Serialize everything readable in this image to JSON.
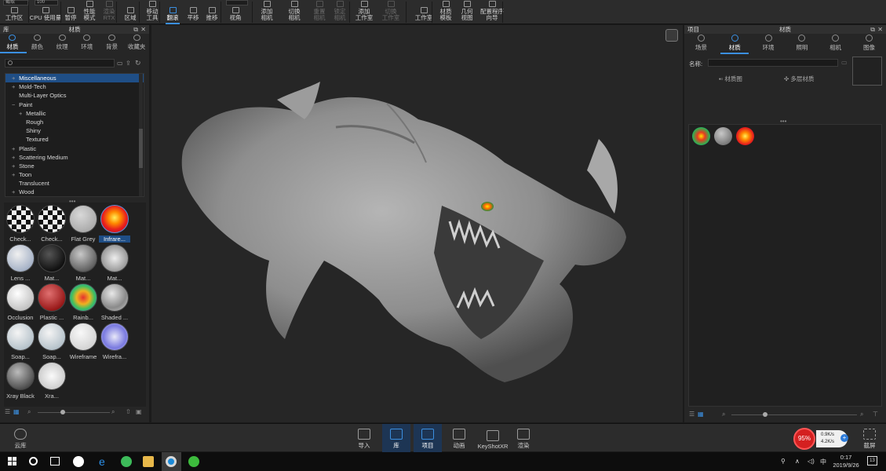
{
  "toolbar": {
    "fields": [
      "截取",
      "100"
    ],
    "buttons": [
      {
        "label": "工作区",
        "state": "normal"
      },
      {
        "label": "CPU 使用量",
        "state": "normal"
      },
      {
        "label": "暂停",
        "state": "normal"
      },
      {
        "label": "性能\n模式",
        "state": "normal"
      },
      {
        "label": "渲染\nRTX",
        "state": "disabled"
      },
      {
        "label": "区域",
        "state": "normal"
      },
      {
        "label": "移动\n工具",
        "state": "normal"
      },
      {
        "label": "翻滚",
        "state": "active"
      },
      {
        "label": "平移",
        "state": "normal"
      },
      {
        "label": "推移",
        "state": "normal"
      },
      {
        "label": "视角",
        "state": "normal"
      },
      {
        "label": "添加\n相机",
        "state": "normal"
      },
      {
        "label": "切换\n相机",
        "state": "normal"
      },
      {
        "label": "重置\n相机",
        "state": "disabled"
      },
      {
        "label": "锁定\n相机",
        "state": "disabled"
      },
      {
        "label": "添加\n工作室",
        "state": "normal"
      },
      {
        "label": "切换\n工作室",
        "state": "disabled"
      },
      {
        "label": "工作室",
        "state": "normal"
      },
      {
        "label": "材质\n模板",
        "state": "normal"
      },
      {
        "label": "几何\n视图",
        "state": "normal"
      },
      {
        "label": "配置程序\n向导",
        "state": "normal"
      }
    ]
  },
  "library": {
    "header_left": "库",
    "title": "材质",
    "tabs": [
      {
        "label": "材质",
        "active": true,
        "icon": "material-icon"
      },
      {
        "label": "颜色",
        "active": false,
        "icon": "color-icon"
      },
      {
        "label": "纹理",
        "active": false,
        "icon": "texture-icon"
      },
      {
        "label": "环境",
        "active": false,
        "icon": "environment-icon"
      },
      {
        "label": "背景",
        "active": false,
        "icon": "background-icon"
      },
      {
        "label": "收藏夹",
        "active": false,
        "icon": "star-icon"
      }
    ],
    "tree": [
      {
        "label": "Miscellaneous",
        "indent": 1,
        "expander": "+",
        "selected": true
      },
      {
        "label": "Mold-Tech",
        "indent": 1,
        "expander": "+",
        "selected": false
      },
      {
        "label": "Multi-Layer Optics",
        "indent": 1,
        "expander": "",
        "selected": false
      },
      {
        "label": "Paint",
        "indent": 1,
        "expander": "−",
        "selected": false
      },
      {
        "label": "Metallic",
        "indent": 2,
        "expander": "+",
        "selected": false
      },
      {
        "label": "Rough",
        "indent": 2,
        "expander": "",
        "selected": false
      },
      {
        "label": "Shiny",
        "indent": 2,
        "expander": "",
        "selected": false
      },
      {
        "label": "Textured",
        "indent": 2,
        "expander": "",
        "selected": false
      },
      {
        "label": "Plastic",
        "indent": 1,
        "expander": "+",
        "selected": false
      },
      {
        "label": "Scattering Medium",
        "indent": 1,
        "expander": "+",
        "selected": false
      },
      {
        "label": "Stone",
        "indent": 1,
        "expander": "+",
        "selected": false
      },
      {
        "label": "Toon",
        "indent": 1,
        "expander": "+",
        "selected": false
      },
      {
        "label": "Translucent",
        "indent": 1,
        "expander": "",
        "selected": false
      },
      {
        "label": "Wood",
        "indent": 1,
        "expander": "+",
        "selected": false
      }
    ],
    "thumbnails": [
      {
        "label": "Check...",
        "style": "checker"
      },
      {
        "label": "Check...",
        "style": "checker"
      },
      {
        "label": "Flat Grey",
        "style": "flat"
      },
      {
        "label": "Infrare...",
        "style": "infrared",
        "selected": true
      },
      {
        "label": "Lens ...",
        "style": "lens"
      },
      {
        "label": "Mat...",
        "style": "black"
      },
      {
        "label": "Mat...",
        "style": "grey"
      },
      {
        "label": "Mat...",
        "style": "swirl"
      },
      {
        "label": "Occlusion",
        "style": "occlusion"
      },
      {
        "label": "Plastic ...",
        "style": "red"
      },
      {
        "label": "Rainb...",
        "style": "rainbow"
      },
      {
        "label": "Shaded ...",
        "style": "shaded"
      },
      {
        "label": "Soap...",
        "style": "soap"
      },
      {
        "label": "Soap...",
        "style": "soap"
      },
      {
        "label": "Wireframe",
        "style": "wire"
      },
      {
        "label": "Wirefra...",
        "style": "wireblue"
      },
      {
        "label": "Xray Black",
        "style": "xrayblack"
      },
      {
        "label": "Xra...",
        "style": "xray"
      }
    ]
  },
  "project": {
    "header_left": "项目",
    "title": "材质",
    "tabs": [
      {
        "label": "场景",
        "active": false
      },
      {
        "label": "材质",
        "active": true
      },
      {
        "label": "环境",
        "active": false
      },
      {
        "label": "照明",
        "active": false
      },
      {
        "label": "相机",
        "active": false
      },
      {
        "label": "图像",
        "active": false
      }
    ],
    "name_label": "名称:",
    "material_graph": "材质图",
    "multi_material": "多层材质",
    "materials": [
      "rainbow",
      "grey",
      "infrared"
    ]
  },
  "bottom": {
    "cloud": "云库",
    "buttons": [
      {
        "label": "导入",
        "active": false
      },
      {
        "label": "库",
        "active": true
      },
      {
        "label": "项目",
        "active": true
      },
      {
        "label": "动画",
        "active": false
      },
      {
        "label": "KeyShotXR",
        "active": false
      },
      {
        "label": "渲染",
        "active": false
      }
    ],
    "perf_percent": "95%",
    "net_up": "0.9K/s",
    "net_down": "4.2K/s",
    "screenshot": "截屏"
  },
  "taskbar": {
    "time": "0:17",
    "date": "2019/9/26",
    "ime": "中",
    "notif": "13"
  }
}
